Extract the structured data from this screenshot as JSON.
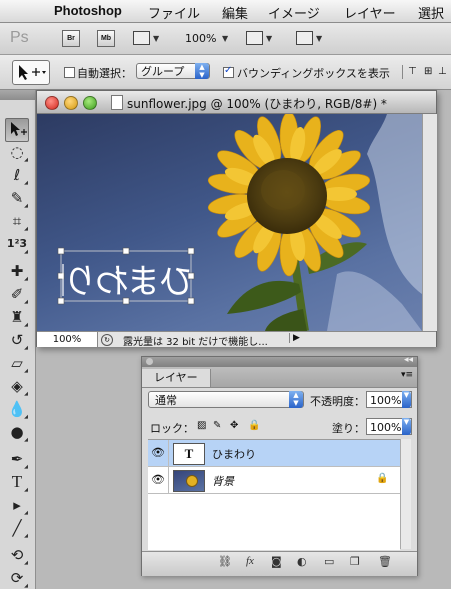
{
  "menubar": {
    "apple": "",
    "app_name": "Photoshop",
    "items": [
      "ファイル",
      "編集",
      "イメージ",
      "レイヤー",
      "選択範"
    ]
  },
  "appbar": {
    "logo": "Ps",
    "bridge_label": "Br",
    "minibridge_label": "Mb",
    "zoom": "100%"
  },
  "options": {
    "auto_select_label": "自動選択：",
    "auto_select_checked": false,
    "auto_select_target": "グループ",
    "bounding_box_label": "バウンディングボックスを表示",
    "bounding_box_checked": true
  },
  "tools": [
    "move-tool",
    "marquee-tool",
    "lasso-tool",
    "quick-selection-tool",
    "crop-tool",
    "eyedropper-tool",
    "healing-brush-tool",
    "brush-tool",
    "clone-stamp-tool",
    "history-brush-tool",
    "eraser-tool",
    "paint-bucket-tool",
    "blur-tool",
    "dodge-tool",
    "pen-tool",
    "type-tool",
    "path-selection-tool",
    "line-tool",
    "3d-rotate-tool",
    "3d-orbit-tool"
  ],
  "document": {
    "title": "sunflower.jpg @ 100% (ひまわり, RGB/8#) *",
    "canvas_text": "ひまわり",
    "zoom": "100%",
    "status": "露光量は 32 bit だけで機能し..."
  },
  "layers_panel": {
    "tab_label": "レイヤー",
    "blend_mode": "通常",
    "opacity_label": "不透明度：",
    "opacity": "100%",
    "lock_label": "ロック：",
    "fill_label": "塗り：",
    "fill": "100%",
    "layers": [
      {
        "name": "ひまわり",
        "type": "text",
        "thumb": "T",
        "selected": true,
        "visible": true
      },
      {
        "name": "背景",
        "type": "image",
        "selected": false,
        "visible": true,
        "locked": true
      }
    ]
  },
  "colors": {
    "sky": "#41588a",
    "selection": "#b7d3f6",
    "accent_blue": "#2a63c9"
  }
}
